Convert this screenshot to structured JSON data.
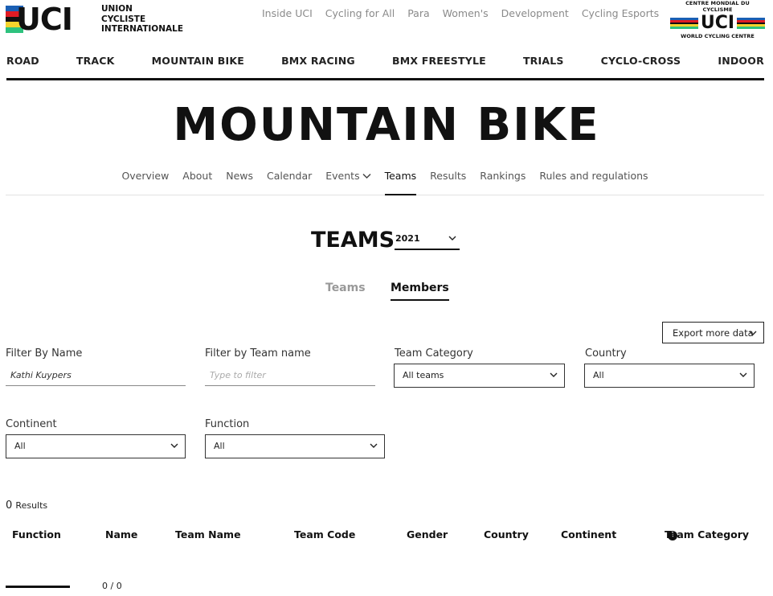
{
  "header": {
    "logo": {
      "letters": "UCI",
      "line1": "UNION",
      "line2": "CYCLISTE",
      "line3": "INTERNATIONALE"
    },
    "top_links": [
      "Inside UCI",
      "Cycling for All",
      "Para",
      "Women's",
      "Development",
      "Cycling Esports"
    ],
    "wcc": {
      "top": "CENTRE MONDIAL DU CYCLISME",
      "mid": "UCI",
      "bottom": "WORLD CYCLING CENTRE"
    },
    "rainbow": [
      "#1a5fb4",
      "#e01b24",
      "#111111",
      "#f6d32d",
      "#2ec27e"
    ]
  },
  "disciplines": [
    "ROAD",
    "TRACK",
    "MOUNTAIN BIKE",
    "BMX RACING",
    "BMX FREESTYLE",
    "TRIALS",
    "CYCLO-CROSS",
    "INDOOR"
  ],
  "hero": {
    "title": "MOUNTAIN BIKE"
  },
  "subnav": {
    "items": [
      "Overview",
      "About",
      "News",
      "Calendar",
      "Events",
      "Teams",
      "Results",
      "Rankings",
      "Rules and regulations"
    ],
    "active": "Teams"
  },
  "teams": {
    "title": "TEAMS",
    "year": "2021"
  },
  "tabs": {
    "teams": "Teams",
    "members": "Members"
  },
  "export": {
    "label": "Export more data"
  },
  "filters": {
    "name": {
      "label": "Filter By Name",
      "value": "Kathi Kuypers"
    },
    "team_name": {
      "label": "Filter by Team name",
      "placeholder": "Type to filter"
    },
    "team_category": {
      "label": "Team Category",
      "value": "All teams"
    },
    "country": {
      "label": "Country",
      "value": "All"
    },
    "continent": {
      "label": "Continent",
      "value": "All"
    },
    "function": {
      "label": "Function",
      "value": "All"
    }
  },
  "results": {
    "count": "0",
    "label": "Results"
  },
  "table": {
    "headers": [
      "Function",
      "Name",
      "Team Name",
      "Team Code",
      "Gender",
      "Country",
      "Continent",
      "Team Category"
    ]
  },
  "pager": {
    "text": "0 / 0"
  }
}
